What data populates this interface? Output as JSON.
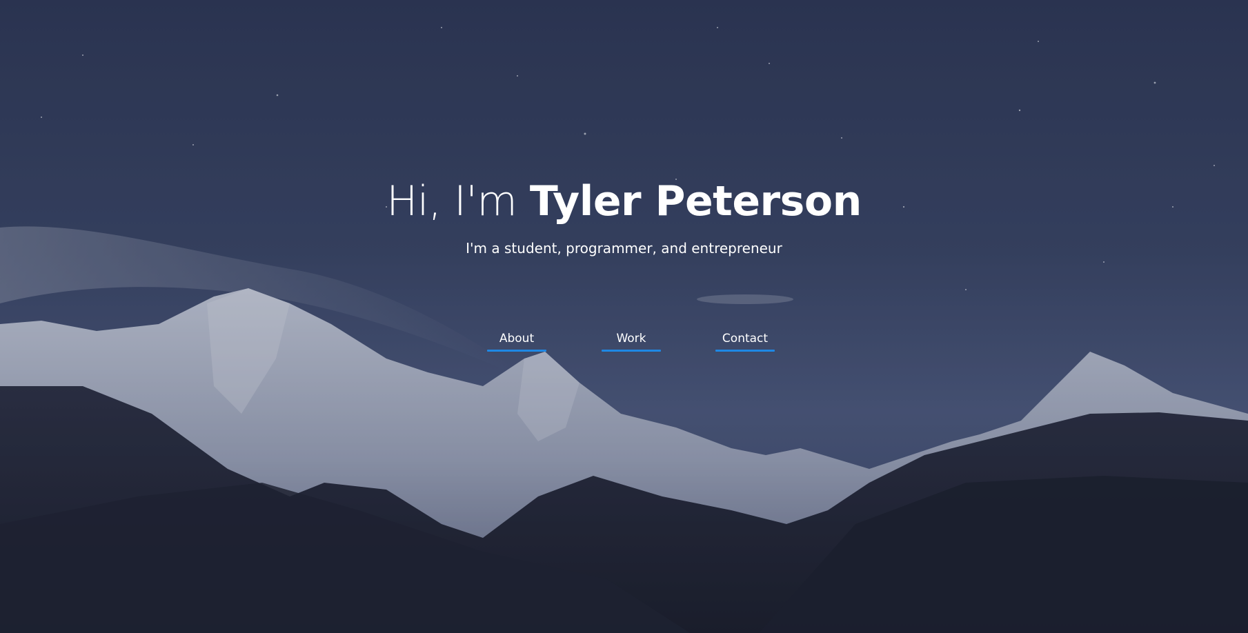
{
  "hero": {
    "greeting": "Hi, I'm ",
    "name": "Tyler Peterson",
    "tagline": "I'm a student, programmer, and entrepreneur"
  },
  "nav": {
    "items": [
      {
        "label": "About"
      },
      {
        "label": "Work"
      },
      {
        "label": "Contact"
      }
    ]
  },
  "colors": {
    "accent": "#1e88e5",
    "text": "#ffffff",
    "sky": "#36425f"
  },
  "background": {
    "image": "night-mountain-landscape"
  }
}
